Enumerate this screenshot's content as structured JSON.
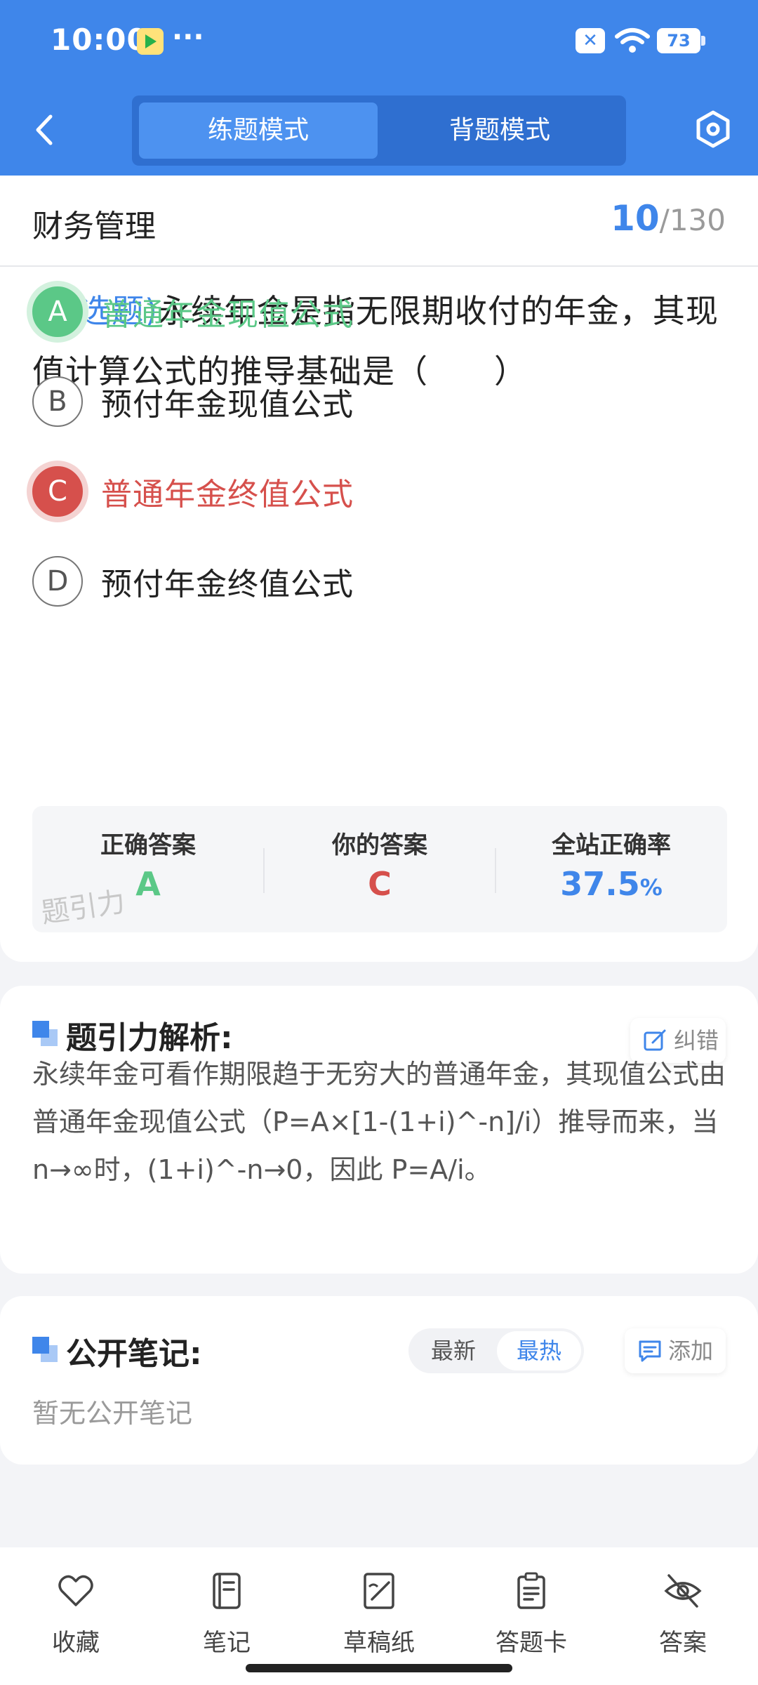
{
  "status_bar": {
    "time": "10:00",
    "dots": "···",
    "x_badge": "✕",
    "battery": "73"
  },
  "header": {
    "modes": [
      "练题模式",
      "背题模式"
    ],
    "active_mode": "练题模式",
    "colors": {
      "header_bg": "#3f86ea",
      "accent": "#3f86ea"
    }
  },
  "question": {
    "subject": "财务管理",
    "current": "10",
    "total": "130",
    "separator": "/",
    "type_label": "(单选题)",
    "text": "永续年金是指无限期收付的年金，其现值计算公式的推导基础是（　　）",
    "options": [
      {
        "letter": "A",
        "text": "普通年金现值公式",
        "state": "correct"
      },
      {
        "letter": "B",
        "text": "预付年金现值公式",
        "state": "normal"
      },
      {
        "letter": "C",
        "text": "普通年金终值公式",
        "state": "wrong"
      },
      {
        "letter": "D",
        "text": "预付年金终值公式",
        "state": "normal"
      }
    ]
  },
  "stats": {
    "correct_label": "正确答案",
    "correct_value": "A",
    "yours_label": "你的答案",
    "yours_value": "C",
    "rate_label": "全站正确率",
    "rate_value": "37.5",
    "rate_unit": "%",
    "watermark": "题引力"
  },
  "analysis": {
    "title": "题引力解析:",
    "report_button": "纠错",
    "text": "永续年金可看作期限趋于无穷大的普通年金，其现值公式由普通年金现值公式（P=A×[1-(1+i)^-n]/i）推导而来，当 n→∞时，(1+i)^-n→0，因此 P=A/i。"
  },
  "notes": {
    "title": "公开笔记:",
    "sort_options": [
      "最新",
      "最热"
    ],
    "active_sort": "最热",
    "add_button": "添加",
    "empty_text": "暂无公开笔记"
  },
  "bottom_nav": {
    "items": [
      {
        "label": "收藏",
        "icon": "heart-icon"
      },
      {
        "label": "笔记",
        "icon": "notebook-icon"
      },
      {
        "label": "草稿纸",
        "icon": "draft-paper-icon"
      },
      {
        "label": "答题卡",
        "icon": "answer-sheet-icon"
      },
      {
        "label": "答案",
        "icon": "eye-off-icon"
      }
    ]
  }
}
